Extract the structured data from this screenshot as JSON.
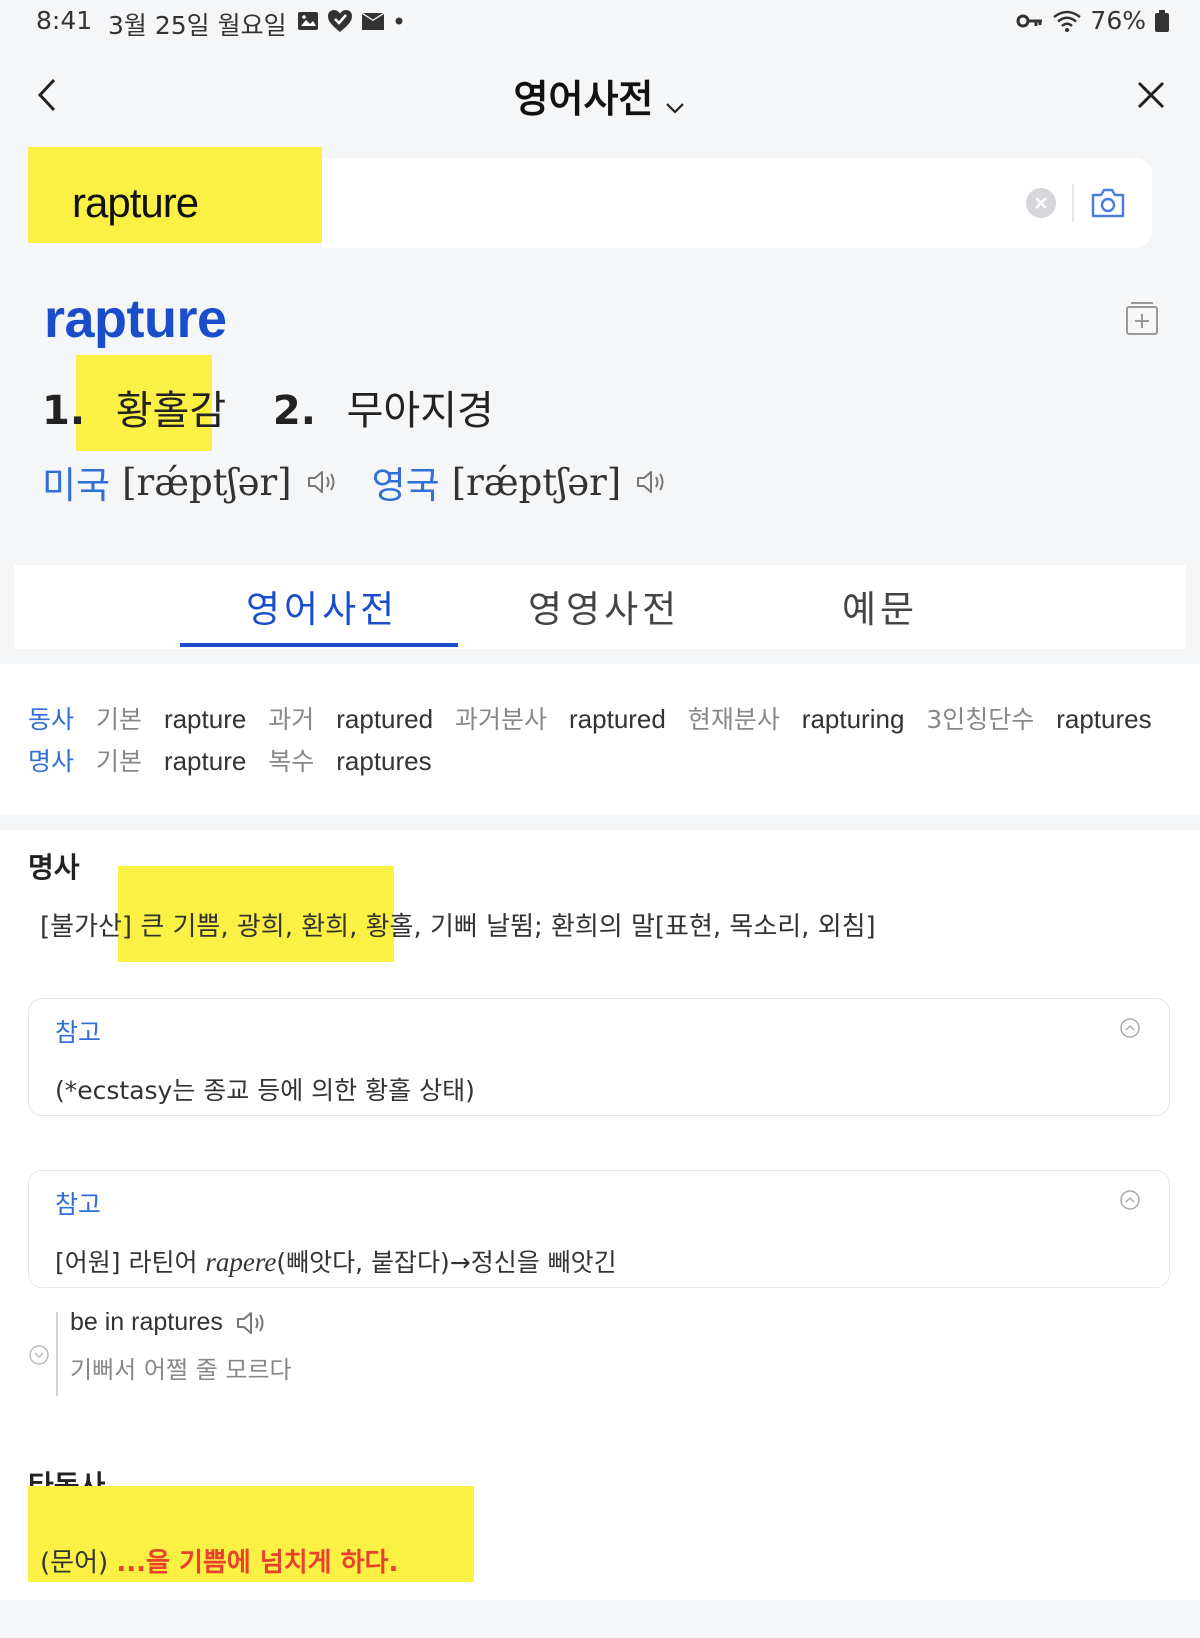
{
  "status_bar": {
    "time": "8:41",
    "date": "3월 25일 월요일",
    "battery": "76%",
    "icons": [
      "gallery-icon",
      "heart-shield-icon",
      "mail-icon",
      "dot-icon",
      "key-icon",
      "wifi-icon",
      "battery-icon"
    ]
  },
  "top_bar": {
    "title": "영어사전",
    "icons": [
      "back-chevron-icon",
      "chevron-down-icon",
      "close-icon"
    ]
  },
  "search": {
    "value": "rapture",
    "icons": [
      "clear-icon",
      "camera-icon"
    ]
  },
  "entry": {
    "headword": "rapture",
    "meanings": [
      {
        "num": "1.",
        "text": "황홀감"
      },
      {
        "num": "2.",
        "text": "무아지경"
      }
    ],
    "pronunciations": [
      {
        "label": "미국",
        "ipa": "[rǽptʃər]"
      },
      {
        "label": "영국",
        "ipa": "[rǽptʃər]"
      }
    ]
  },
  "tabs": [
    {
      "label": "영어사전",
      "active": true
    },
    {
      "label": "영영사전",
      "active": false
    },
    {
      "label": "예문",
      "active": false
    }
  ],
  "word_forms": {
    "verb": {
      "pos": "동사",
      "items": [
        {
          "key": "기본",
          "value": "rapture"
        },
        {
          "key": "과거",
          "value": "raptured"
        },
        {
          "key": "과거분사",
          "value": "raptured"
        },
        {
          "key": "현재분사",
          "value": "rapturing"
        },
        {
          "key": "3인칭단수",
          "value": "raptures"
        }
      ]
    },
    "noun": {
      "pos": "명사",
      "items": [
        {
          "key": "기본",
          "value": "rapture"
        },
        {
          "key": "복수",
          "value": "raptures"
        }
      ]
    }
  },
  "noun_section": {
    "pos": "명사",
    "definition_prefix": "[불가산]",
    "definition_highlight": "큰 기쁨, 광희, 환희, 황홀,",
    "definition_rest": "기뻐 날뜀; 환희의 말[표현, 목소리, 외침]",
    "notes": [
      {
        "title": "참고",
        "text": "(*ecstasy는 종교 등에 의한 황홀 상태)"
      },
      {
        "title": "참고",
        "text_prefix": "[어원] 라틴어 ",
        "text_italic": "rapere",
        "text_suffix": "(빼앗다, 붙잡다)→정신을 빼앗긴"
      }
    ],
    "example": {
      "en": "be in raptures",
      "ko": "기뻐서 어쩔 줄 모르다"
    }
  },
  "verb_section": {
    "pos": "타동사",
    "definition_prefix": "(문어)",
    "definition_red": "...을 기쁨에 넘치게 하다."
  },
  "colors": {
    "accent_blue": "#1a4dcc",
    "label_blue": "#2f6fd6",
    "highlight_yellow": "#fbf144",
    "definition_red": "#e8412d"
  }
}
